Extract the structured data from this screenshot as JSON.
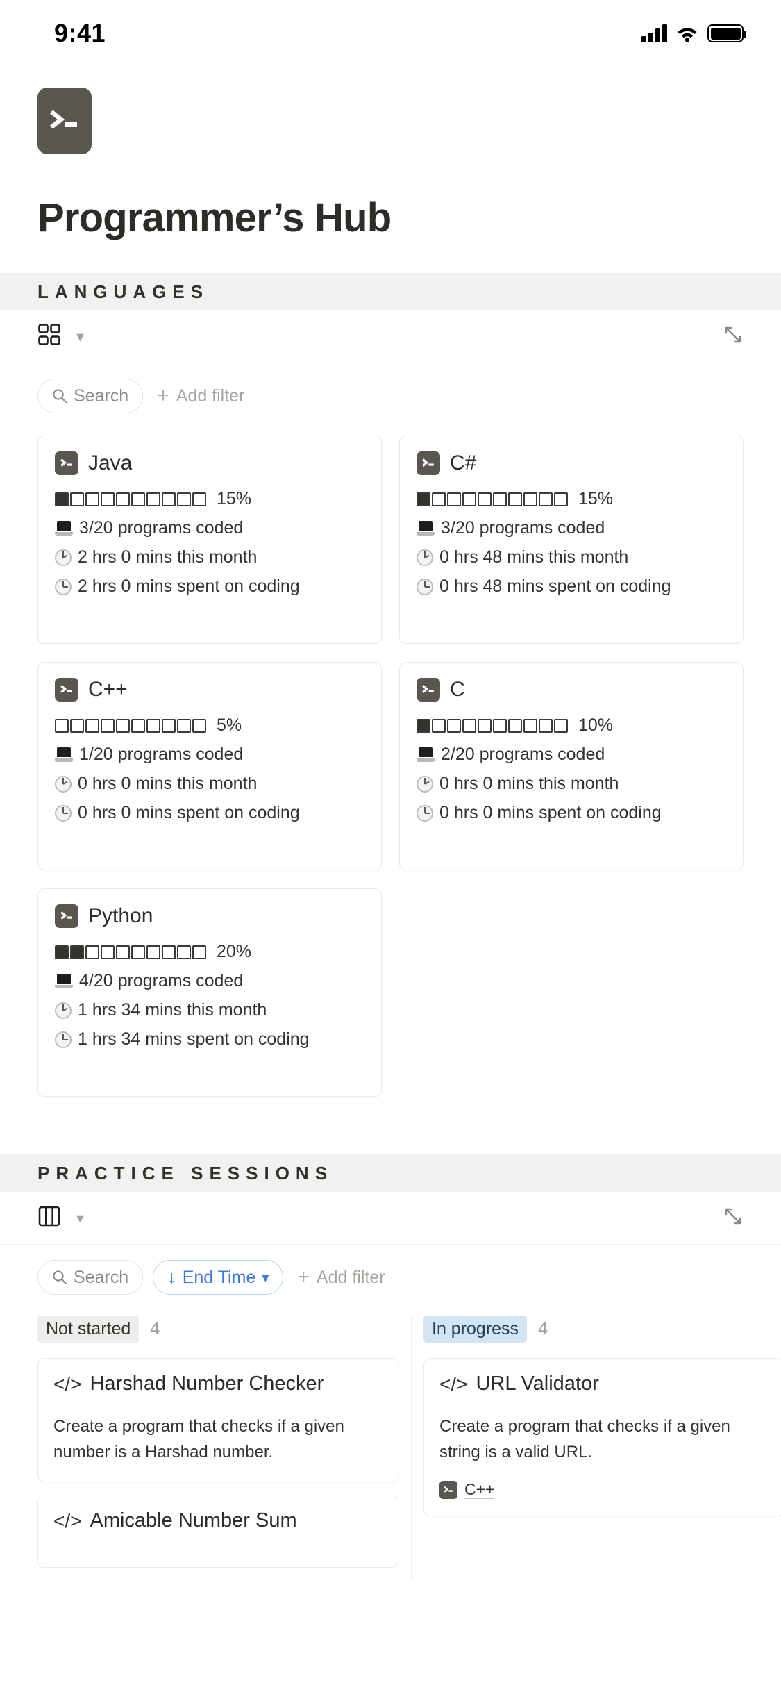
{
  "status_bar": {
    "time": "9:41",
    "signal_icon": "cellular-signal-icon",
    "wifi_icon": "wifi-icon",
    "battery_icon": "battery-full-icon"
  },
  "header": {
    "app_icon": "terminal-prompt-icon",
    "title": "Programmer’s Hub"
  },
  "languages_section": {
    "banner": "LANGUAGES",
    "view_icon": "gallery-view-icon",
    "view_chevron": "chevron-down-icon",
    "expand_icon": "expand-diagonal-icon",
    "search_placeholder": "Search",
    "search_icon": "search-icon",
    "add_filter_label": "Add filter",
    "add_filter_icon": "plus-icon",
    "cards": [
      {
        "icon": "terminal-prompt-icon",
        "name": "Java",
        "percent_label": "15%",
        "filled_blocks": 1,
        "total_blocks": 10,
        "programs": "3/20 programs coded",
        "this_month": "2 hrs 0 mins this month",
        "total_spent": "2 hrs 0 mins spent on coding",
        "programs_icon": "laptop-icon",
        "month_icon": "clock-two-icon",
        "spent_icon": "clock-three-icon"
      },
      {
        "icon": "terminal-prompt-icon",
        "name": "C#",
        "percent_label": "15%",
        "filled_blocks": 1,
        "total_blocks": 10,
        "programs": "3/20 programs coded",
        "this_month": "0 hrs 48 mins this month",
        "total_spent": "0 hrs 48 mins spent on coding",
        "programs_icon": "laptop-icon",
        "month_icon": "clock-two-icon",
        "spent_icon": "clock-three-icon"
      },
      {
        "icon": "terminal-prompt-icon",
        "name": "C++",
        "percent_label": "5%",
        "filled_blocks": 0,
        "total_blocks": 10,
        "programs": "1/20 programs coded",
        "this_month": "0 hrs 0 mins this month",
        "total_spent": "0 hrs 0 mins spent on coding",
        "programs_icon": "laptop-icon",
        "month_icon": "clock-two-icon",
        "spent_icon": "clock-three-icon"
      },
      {
        "icon": "terminal-prompt-icon",
        "name": "C",
        "percent_label": "10%",
        "filled_blocks": 1,
        "total_blocks": 10,
        "programs": "2/20 programs coded",
        "this_month": "0 hrs 0 mins this month",
        "total_spent": "0 hrs 0 mins spent on coding",
        "programs_icon": "laptop-icon",
        "month_icon": "clock-two-icon",
        "spent_icon": "clock-three-icon"
      },
      {
        "icon": "terminal-prompt-icon",
        "name": "Python",
        "percent_label": "20%",
        "filled_blocks": 2,
        "total_blocks": 10,
        "programs": "4/20 programs coded",
        "this_month": "1 hrs 34 mins this month",
        "total_spent": "1 hrs 34 mins spent on coding",
        "programs_icon": "laptop-icon",
        "month_icon": "clock-two-icon",
        "spent_icon": "clock-three-icon"
      }
    ]
  },
  "practice_section": {
    "banner": "PRACTICE SESSIONS",
    "view_icon": "board-view-icon",
    "view_chevron": "chevron-down-icon",
    "expand_icon": "expand-diagonal-icon",
    "search_placeholder": "Search",
    "search_icon": "search-icon",
    "sort_label": "End Time",
    "sort_arrow_icon": "arrow-down-icon",
    "sort_chevron_icon": "chevron-down-icon",
    "sort_accent_color": "#3b7ad9",
    "add_filter_label": "Add filter",
    "add_filter_icon": "plus-icon",
    "columns": [
      {
        "status": "Not started",
        "count": "4",
        "badge_color": "#eeedeb",
        "cards": [
          {
            "icon": "code-brackets-icon",
            "title": "Harshad Number Checker",
            "description": "Create a program that checks if a given number is a Harshad number.",
            "tag": null
          },
          {
            "icon": "code-brackets-icon",
            "title": "Amicable Number Sum",
            "description": "",
            "tag": null
          }
        ]
      },
      {
        "status": "In progress",
        "count": "4",
        "badge_color": "#d3e5f3",
        "cards": [
          {
            "icon": "code-brackets-icon",
            "title": "URL Validator",
            "description": "Create a program that checks if a given string is a valid URL.",
            "tag": "C++",
            "tag_icon": "terminal-prompt-icon"
          }
        ]
      }
    ]
  }
}
